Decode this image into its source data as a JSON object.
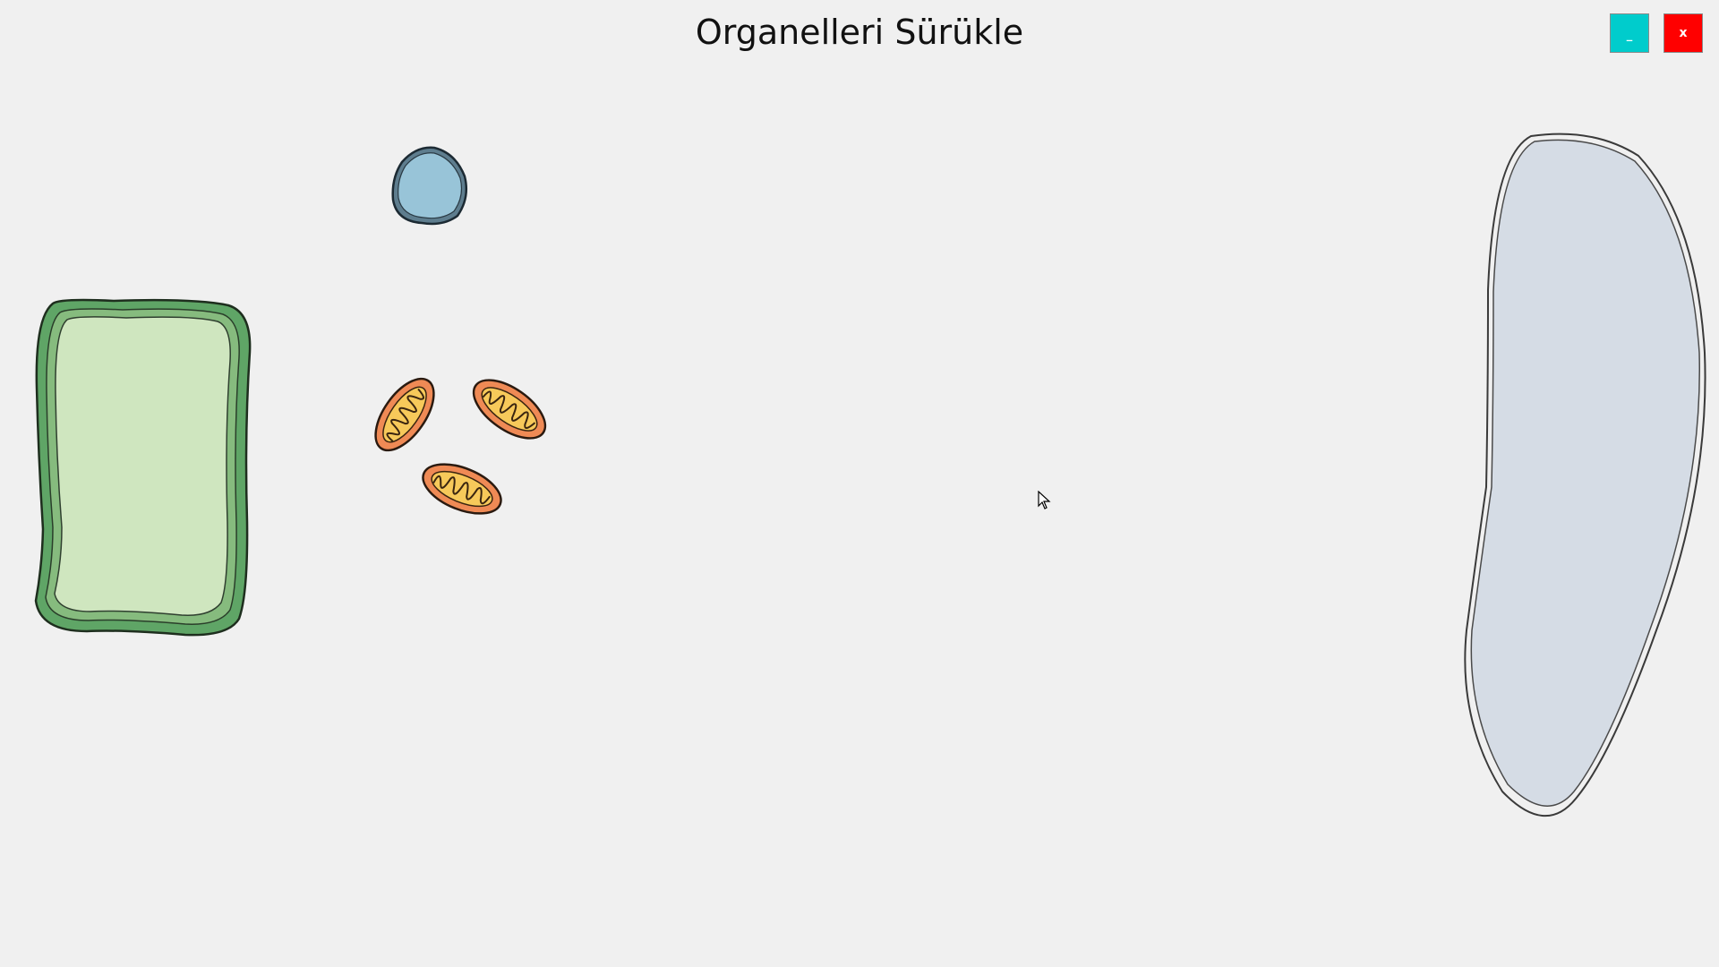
{
  "window": {
    "title": "Organelleri Sürükle",
    "minimize_label": "_",
    "close_label": "x"
  },
  "colors": {
    "background": "#f0f0f0",
    "minimize_button": "#00cccc",
    "close_button": "#ff0000",
    "plant_cell_wall": "#5fa566",
    "plant_cell_fill": "#cfe6bf",
    "nucleus_fill": "#98c4d8",
    "mitochondria_outer": "#ef8a55",
    "mitochondria_inner": "#f7c95a",
    "animal_cell_fill": "#d5dce5"
  },
  "game_objects": [
    {
      "name": "plant-cell",
      "icon": "plant-cell-icon",
      "draggable": true
    },
    {
      "name": "nucleus",
      "icon": "nucleus-icon",
      "draggable": true
    },
    {
      "name": "mitochondrion",
      "icon": "mitochondrion-icon",
      "count": 3,
      "draggable": true
    },
    {
      "name": "animal-cell",
      "icon": "animal-cell-icon",
      "draggable": false
    }
  ]
}
